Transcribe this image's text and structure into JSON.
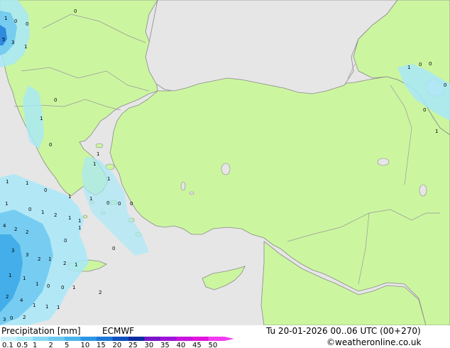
{
  "map": {
    "colors": {
      "sea": "#e6e6e6",
      "land": "#ccf5a0",
      "coast": "#8a8a8a",
      "border": "#999999",
      "precip_light": "#a8e8f8",
      "precip_mid": "#6cc8f0",
      "precip_heavy": "#3aa8e8",
      "precip_max": "#1e78d8"
    },
    "labels": [
      {
        "v": "1"
      },
      {
        "v": "0"
      },
      {
        "v": "0"
      },
      {
        "v": "0"
      },
      {
        "v": "5"
      },
      {
        "v": "3"
      },
      {
        "v": "1"
      },
      {
        "v": "1"
      },
      {
        "v": "0"
      },
      {
        "v": "0"
      },
      {
        "v": "0"
      },
      {
        "v": "0"
      },
      {
        "v": "1"
      },
      {
        "v": "0"
      },
      {
        "v": "1"
      },
      {
        "v": "0"
      },
      {
        "v": "1"
      },
      {
        "v": "1"
      },
      {
        "v": "1"
      },
      {
        "v": "1"
      },
      {
        "v": "1"
      },
      {
        "v": "0"
      },
      {
        "v": "1"
      },
      {
        "v": "1"
      },
      {
        "v": "0"
      },
      {
        "v": "0"
      },
      {
        "v": "0"
      },
      {
        "v": "1"
      },
      {
        "v": "0"
      },
      {
        "v": "1"
      },
      {
        "v": "2"
      },
      {
        "v": "1"
      },
      {
        "v": "1"
      },
      {
        "v": "1"
      },
      {
        "v": "4"
      },
      {
        "v": "2"
      },
      {
        "v": "2"
      },
      {
        "v": "0"
      },
      {
        "v": "3"
      },
      {
        "v": "3"
      },
      {
        "v": "2"
      },
      {
        "v": "1"
      },
      {
        "v": "2"
      },
      {
        "v": "1"
      },
      {
        "v": "0"
      },
      {
        "v": "1"
      },
      {
        "v": "2"
      },
      {
        "v": "1"
      },
      {
        "v": "1"
      },
      {
        "v": "1"
      },
      {
        "v": "0"
      },
      {
        "v": "0"
      },
      {
        "v": "2"
      },
      {
        "v": "4"
      },
      {
        "v": "1"
      },
      {
        "v": "1"
      },
      {
        "v": "1"
      },
      {
        "v": "3"
      },
      {
        "v": "0"
      },
      {
        "v": "2"
      }
    ]
  },
  "footer": {
    "title": "Precipitation [mm]",
    "model": "ECMWF",
    "datetime": "Tu 20-01-2026 00..06 UTC (00+270)",
    "credit": "©weatheronline.co.uk",
    "scale": [
      {
        "label": "0.1",
        "color": "#c8f0fa"
      },
      {
        "label": "0.5",
        "color": "#a8e8f8"
      },
      {
        "label": "1",
        "color": "#88d8f4"
      },
      {
        "label": "2",
        "color": "#6cc8f0"
      },
      {
        "label": "5",
        "color": "#4cb4ec"
      },
      {
        "label": "10",
        "color": "#2c96e4"
      },
      {
        "label": "15",
        "color": "#1e78d8"
      },
      {
        "label": "20",
        "color": "#1050c0"
      },
      {
        "label": "25",
        "color": "#0a2ca0"
      },
      {
        "label": "30",
        "color": "#7814c8"
      },
      {
        "label": "35",
        "color": "#a014d8"
      },
      {
        "label": "40",
        "color": "#c814dc"
      },
      {
        "label": "45",
        "color": "#e014dc"
      },
      {
        "label": "50",
        "color": "#f03cf0"
      }
    ]
  }
}
